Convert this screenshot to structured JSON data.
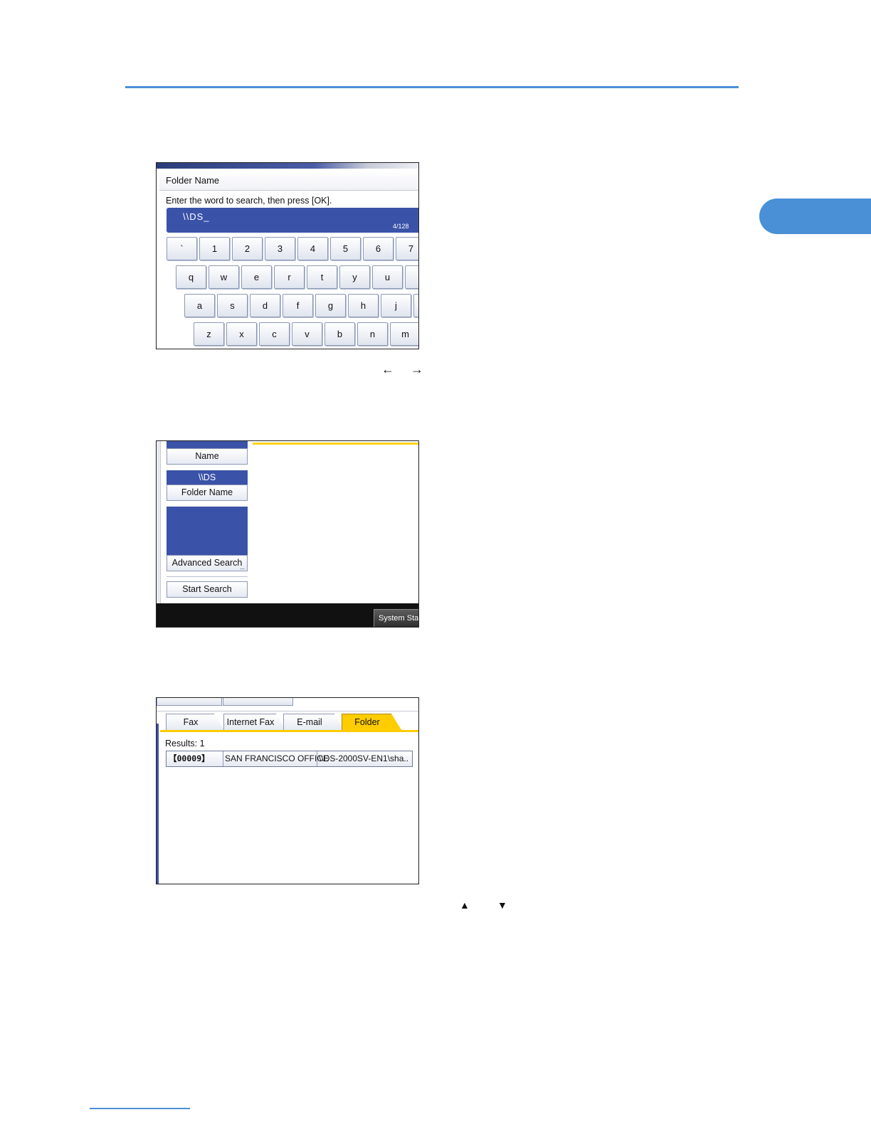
{
  "colors": {
    "accent": "#4a90d6",
    "ui_blue": "#3a53a8",
    "tab_active": "#ffcc00"
  },
  "screen1": {
    "title": "Folder Name",
    "prompt": "Enter the word to search, then press [OK].",
    "input_value": "\\\\DS_",
    "char_count": "4/128",
    "keys_row1": [
      "`",
      "1",
      "2",
      "3",
      "4",
      "5",
      "6",
      "7"
    ],
    "keys_row2": [
      "q",
      "w",
      "e",
      "r",
      "t",
      "y",
      "u",
      ""
    ],
    "keys_row3": [
      "a",
      "s",
      "d",
      "f",
      "g",
      "h",
      "j",
      ""
    ],
    "keys_row4": [
      "z",
      "x",
      "c",
      "v",
      "b",
      "n",
      "m"
    ]
  },
  "arrows1": {
    "left": "←",
    "right": "→"
  },
  "screen2": {
    "name_button": "Name",
    "folder_value": "\\\\DS",
    "folder_button": "Folder Name",
    "advanced_button": "Advanced Search",
    "advanced_ellipsis": "...",
    "start_button": "Start Search",
    "status_button": "System Status"
  },
  "screen3": {
    "tabs": [
      "Fax",
      "Internet Fax",
      "E-mail",
      "Folder"
    ],
    "results_label": "Results: 1",
    "row": {
      "id": "【00009】",
      "name": "SAN FRANCISCO OFFICE",
      "path": "\\\\DS-2000SV-EN1\\sha.."
    }
  },
  "arrows2": {
    "up": "▲",
    "down": "▼"
  }
}
